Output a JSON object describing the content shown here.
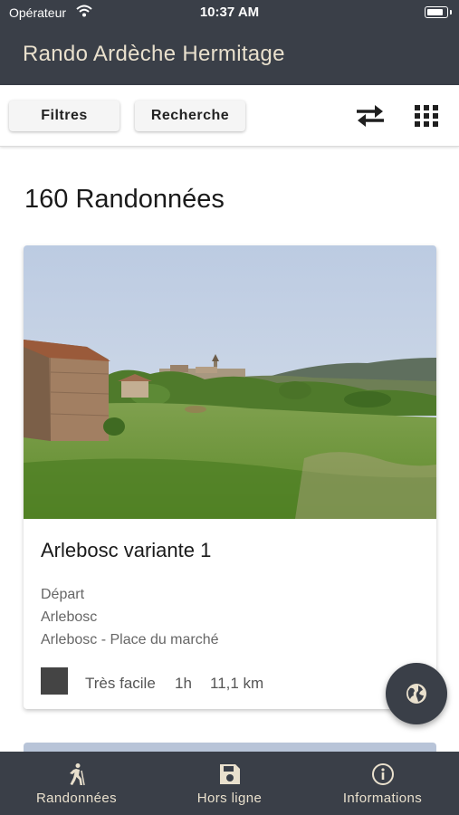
{
  "status_bar": {
    "carrier": "Opérateur",
    "time": "10:37 AM",
    "wifi_icon": "wifi-icon",
    "battery_icon": "battery-icon"
  },
  "app": {
    "title": "Rando Ardèche Hermitage"
  },
  "toolbar": {
    "filters_label": "Filtres",
    "search_label": "Recherche",
    "swap_icon": "swap-arrows-icon",
    "grid_icon": "grid-icon"
  },
  "results": {
    "count_label": "160 Randonnées"
  },
  "hike": {
    "name": "Arlebosc variante 1",
    "departure_label": "Départ",
    "departure_town": "Arlebosc",
    "departure_place": "Arlebosc - Place du marché",
    "difficulty": "Très facile",
    "duration": "1h",
    "distance": "11,1 km",
    "difficulty_color": "#444444"
  },
  "fab": {
    "icon": "globe-icon"
  },
  "tabs": [
    {
      "label": "Randonnées",
      "icon": "hiker-icon"
    },
    {
      "label": "Hors ligne",
      "icon": "floppy-disk-icon"
    },
    {
      "label": "Informations",
      "icon": "info-icon"
    }
  ],
  "colors": {
    "header_bg": "#3a3f48",
    "header_text": "#e9e0cd",
    "page_bg": "#ffffff"
  }
}
